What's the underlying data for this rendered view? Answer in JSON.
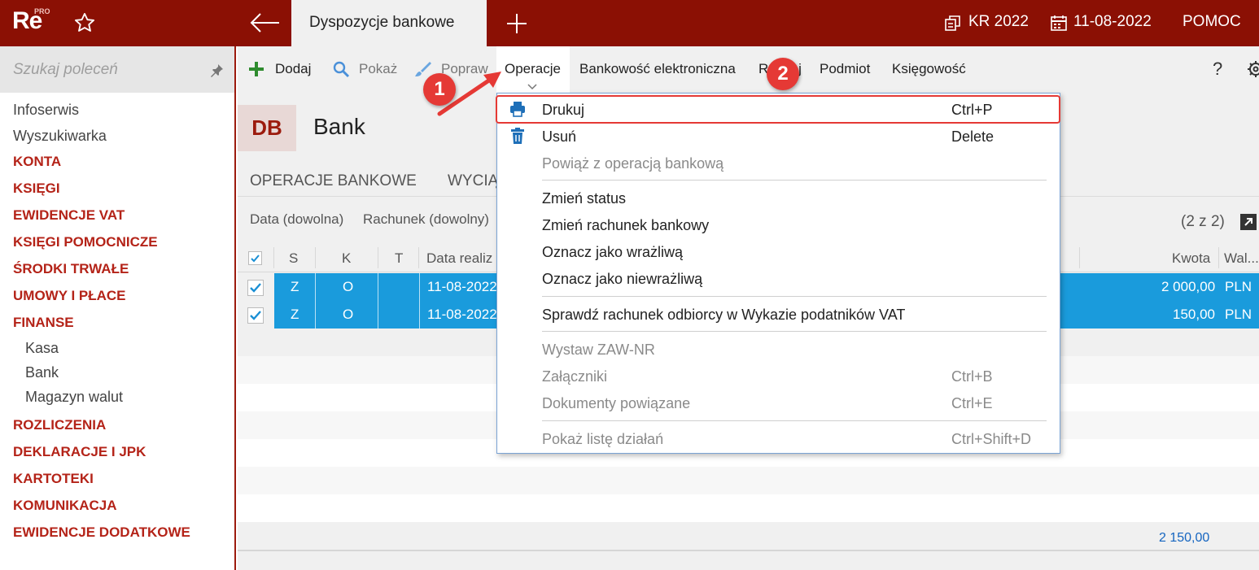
{
  "topbar": {
    "logo_text": "Re",
    "logo_sup": "PRO",
    "tab_title": "Dyspozycje bankowe",
    "period": "KR 2022",
    "date": "11-08-2022",
    "help_label": "POMOC"
  },
  "sidebar": {
    "search_placeholder": "Szukaj poleceń",
    "items": {
      "infoserwis": "Infoserwis",
      "wyszukiwarka": "Wyszukiwarka",
      "konta": "KONTA",
      "ksiegi": "KSIĘGI",
      "ewidencje_vat": "EWIDENCJE VAT",
      "ksiegi_pomocnicze": "KSIĘGI POMOCNICZE",
      "srodki_trwale": "ŚRODKI TRWAŁE",
      "umowy_place": "UMOWY I PŁACE",
      "finanse": "FINANSE",
      "kasa": "Kasa",
      "bank": "Bank",
      "magazyn_walut": "Magazyn walut",
      "rozliczenia": "ROZLICZENIA",
      "deklaracje": "DEKLARACJE I JPK",
      "kartoteki": "KARTOTEKI",
      "komunikacja": "KOMUNIKACJA",
      "ewidencje_dodatkowe": "EWIDENCJE DODATKOWE"
    }
  },
  "toolbar": {
    "dodaj": "Dodaj",
    "pokaz": "Pokaż",
    "popraw": "Popraw",
    "operacje": "Operacje",
    "bankowosc": "Bankowość elektroniczna",
    "rodzaj": "Rodzaj",
    "podmiot": "Podmiot",
    "ksiegowosc": "Księgowość",
    "help": "?"
  },
  "header": {
    "badge": "DB",
    "title": "Bank"
  },
  "subtabs": {
    "operacje_bankowe": "OPERACJE BANKOWE",
    "wyciagi": "WYCIĄ"
  },
  "filters": {
    "data": "Data (dowolna)",
    "rachunek": "Rachunek (dowolny)",
    "count": "(2 z 2)"
  },
  "grid": {
    "columns": {
      "s": "S",
      "k": "K",
      "t": "T",
      "data": "Data realiz",
      "kwota": "Kwota",
      "waluta": "Wal..."
    },
    "rows": [
      {
        "s": "Z",
        "k": "O",
        "data": "11-08-2022",
        "kwota": "2 000,00",
        "waluta": "PLN"
      },
      {
        "s": "Z",
        "k": "O",
        "data": "11-08-2022",
        "kwota": "150,00",
        "waluta": "PLN"
      }
    ],
    "total": "2 150,00"
  },
  "menu": {
    "drukuj": "Drukuj",
    "drukuj_sc": "Ctrl+P",
    "usun": "Usuń",
    "usun_sc": "Delete",
    "powiaz": "Powiąż z operacją bankową",
    "zmien_status": "Zmień status",
    "zmien_rachunek": "Zmień rachunek bankowy",
    "oznacz_wrazliwa": "Oznacz jako wrażliwą",
    "oznacz_niewrazliwa": "Oznacz jako niewrażliwą",
    "sprawdz": "Sprawdź rachunek odbiorcy w Wykazie podatników VAT",
    "wystaw": "Wystaw ZAW-NR",
    "zalaczniki": "Załączniki",
    "zalaczniki_sc": "Ctrl+B",
    "dokumenty": "Dokumenty powiązane",
    "dokumenty_sc": "Ctrl+E",
    "pokaz_liste": "Pokaż listę działań",
    "pokaz_liste_sc": "Ctrl+Shift+D"
  },
  "annotations": {
    "one": "1",
    "two": "2"
  },
  "colors": {
    "brand": "#8b1004",
    "selection": "#1a9bdc",
    "annotation": "#e53935"
  }
}
